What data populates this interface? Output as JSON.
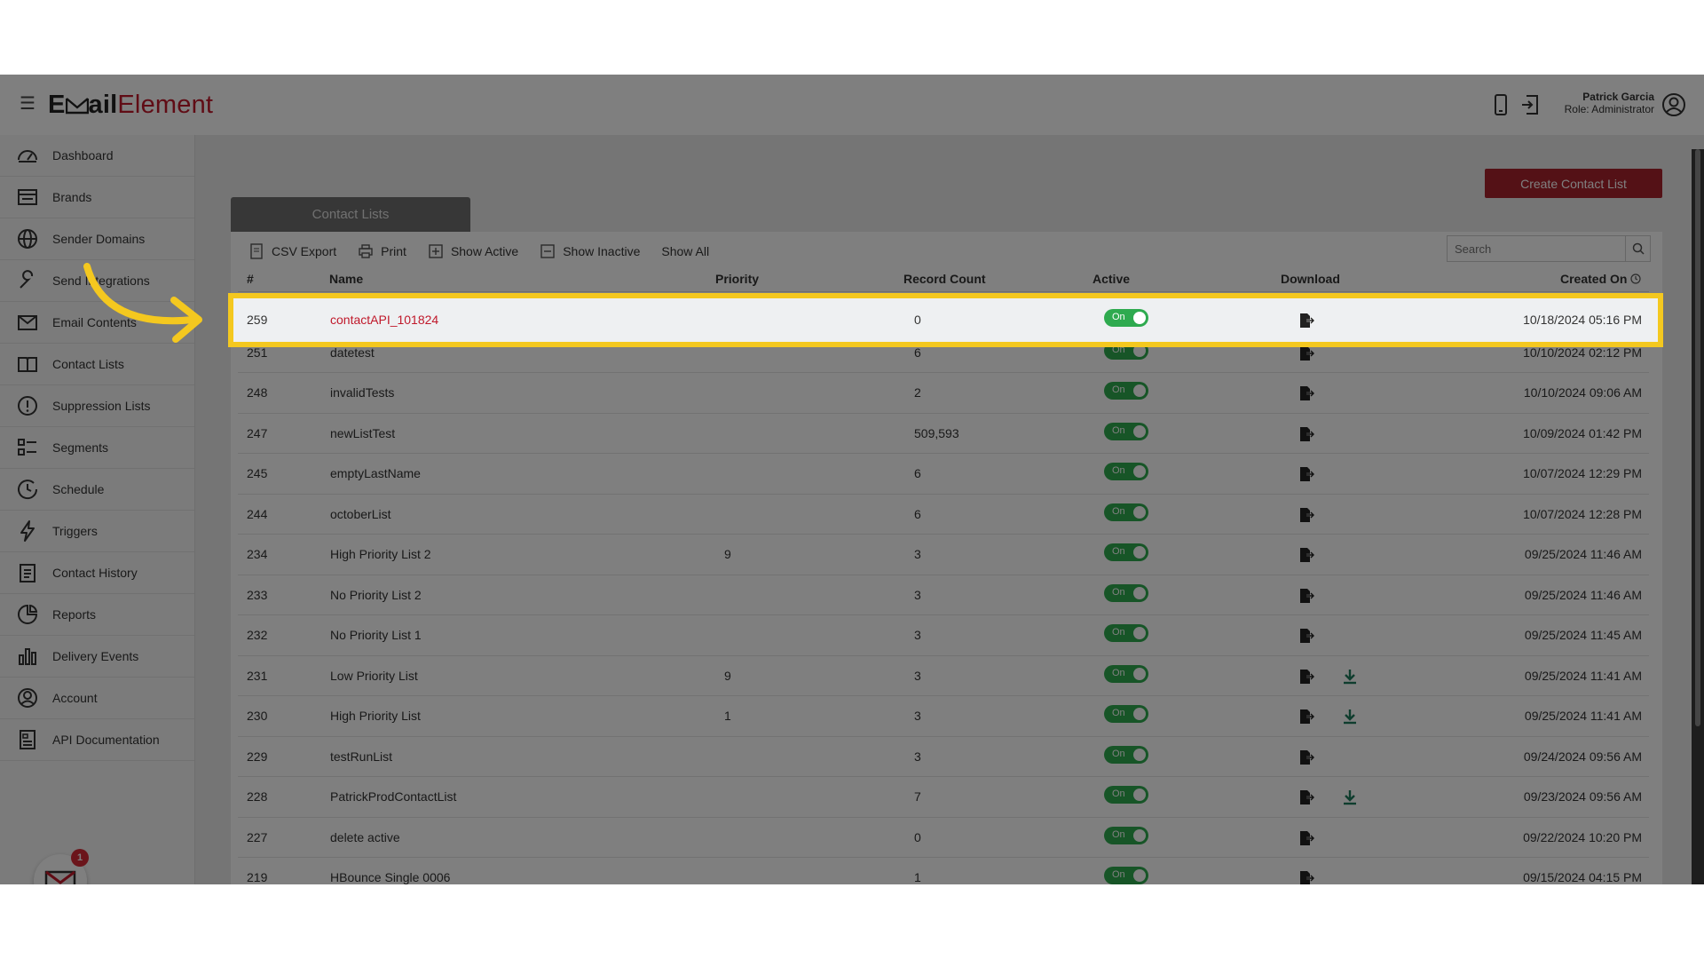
{
  "app": {
    "logo_part1": "E",
    "logo_part2": "ail",
    "logo_part3": "Element"
  },
  "user": {
    "name": "Patrick Garcia",
    "role": "Role: Administrator"
  },
  "sidebar": {
    "items": [
      {
        "label": "Dashboard",
        "icon": "dashboard-icon"
      },
      {
        "label": "Brands",
        "icon": "brands-icon"
      },
      {
        "label": "Sender Domains",
        "icon": "globe-icon"
      },
      {
        "label": "Send Integrations",
        "icon": "wrench-icon"
      },
      {
        "label": "Email Contents",
        "icon": "envelope-icon"
      },
      {
        "label": "Contact Lists",
        "icon": "book-icon"
      },
      {
        "label": "Suppression Lists",
        "icon": "alert-icon"
      },
      {
        "label": "Segments",
        "icon": "segments-icon"
      },
      {
        "label": "Schedule",
        "icon": "clock-icon"
      },
      {
        "label": "Triggers",
        "icon": "bolt-icon"
      },
      {
        "label": "Contact History",
        "icon": "clipboard-icon"
      },
      {
        "label": "Reports",
        "icon": "pie-icon"
      },
      {
        "label": "Delivery Events",
        "icon": "bars-icon"
      },
      {
        "label": "Account",
        "icon": "user-circle-icon"
      },
      {
        "label": "API Documentation",
        "icon": "document-icon"
      }
    ],
    "bot_badge": "1"
  },
  "main": {
    "create_button": "Create Contact List",
    "tab_label": "Contact Lists",
    "toolbar": {
      "csv_export": "CSV Export",
      "print": "Print",
      "show_active": "Show Active",
      "show_inactive": "Show Inactive",
      "show_all": "Show All"
    },
    "search_placeholder": "Search",
    "columns": {
      "id": "#",
      "name": "Name",
      "priority": "Priority",
      "record_count": "Record Count",
      "active": "Active",
      "download": "Download",
      "created_on": "Created On"
    },
    "toggle_label": "On",
    "rows": [
      {
        "id": "259",
        "name": "contactAPI_101824",
        "priority": "",
        "count": "0",
        "created": "10/18/2024 05:16 PM",
        "extra_dl": false
      },
      {
        "id": "251",
        "name": "datetest",
        "priority": "",
        "count": "6",
        "created": "10/10/2024 02:12 PM",
        "extra_dl": false
      },
      {
        "id": "248",
        "name": "invalidTests",
        "priority": "",
        "count": "2",
        "created": "10/10/2024 09:06 AM",
        "extra_dl": false
      },
      {
        "id": "247",
        "name": "newListTest",
        "priority": "",
        "count": "509,593",
        "created": "10/09/2024 01:42 PM",
        "extra_dl": false
      },
      {
        "id": "245",
        "name": "emptyLastName",
        "priority": "",
        "count": "6",
        "created": "10/07/2024 12:29 PM",
        "extra_dl": false
      },
      {
        "id": "244",
        "name": "octoberList",
        "priority": "",
        "count": "6",
        "created": "10/07/2024 12:28 PM",
        "extra_dl": false
      },
      {
        "id": "234",
        "name": "High Priority List 2",
        "priority": "9",
        "count": "3",
        "created": "09/25/2024 11:46 AM",
        "extra_dl": false
      },
      {
        "id": "233",
        "name": "No Priority List 2",
        "priority": "",
        "count": "3",
        "created": "09/25/2024 11:46 AM",
        "extra_dl": false
      },
      {
        "id": "232",
        "name": "No Priority List 1",
        "priority": "",
        "count": "3",
        "created": "09/25/2024 11:45 AM",
        "extra_dl": false
      },
      {
        "id": "231",
        "name": "Low Priority List",
        "priority": "9",
        "count": "3",
        "created": "09/25/2024 11:41 AM",
        "extra_dl": true
      },
      {
        "id": "230",
        "name": "High Priority List",
        "priority": "1",
        "count": "3",
        "created": "09/25/2024 11:41 AM",
        "extra_dl": true
      },
      {
        "id": "229",
        "name": "testRunList",
        "priority": "",
        "count": "3",
        "created": "09/24/2024 09:56 AM",
        "extra_dl": false
      },
      {
        "id": "228",
        "name": "PatrickProdContactList",
        "priority": "",
        "count": "7",
        "created": "09/23/2024 09:56 AM",
        "extra_dl": true
      },
      {
        "id": "227",
        "name": "delete active",
        "priority": "",
        "count": "0",
        "created": "09/22/2024 10:20 PM",
        "extra_dl": false
      },
      {
        "id": "219",
        "name": "HBounce Single 0006",
        "priority": "",
        "count": "1",
        "created": "09/15/2024 04:15 PM",
        "extra_dl": false
      }
    ]
  },
  "colors": {
    "brand_red": "#c0192b",
    "button_red": "#a8232d",
    "toggle_green": "#2eaa4f",
    "highlight_yellow": "#f4c81f"
  }
}
